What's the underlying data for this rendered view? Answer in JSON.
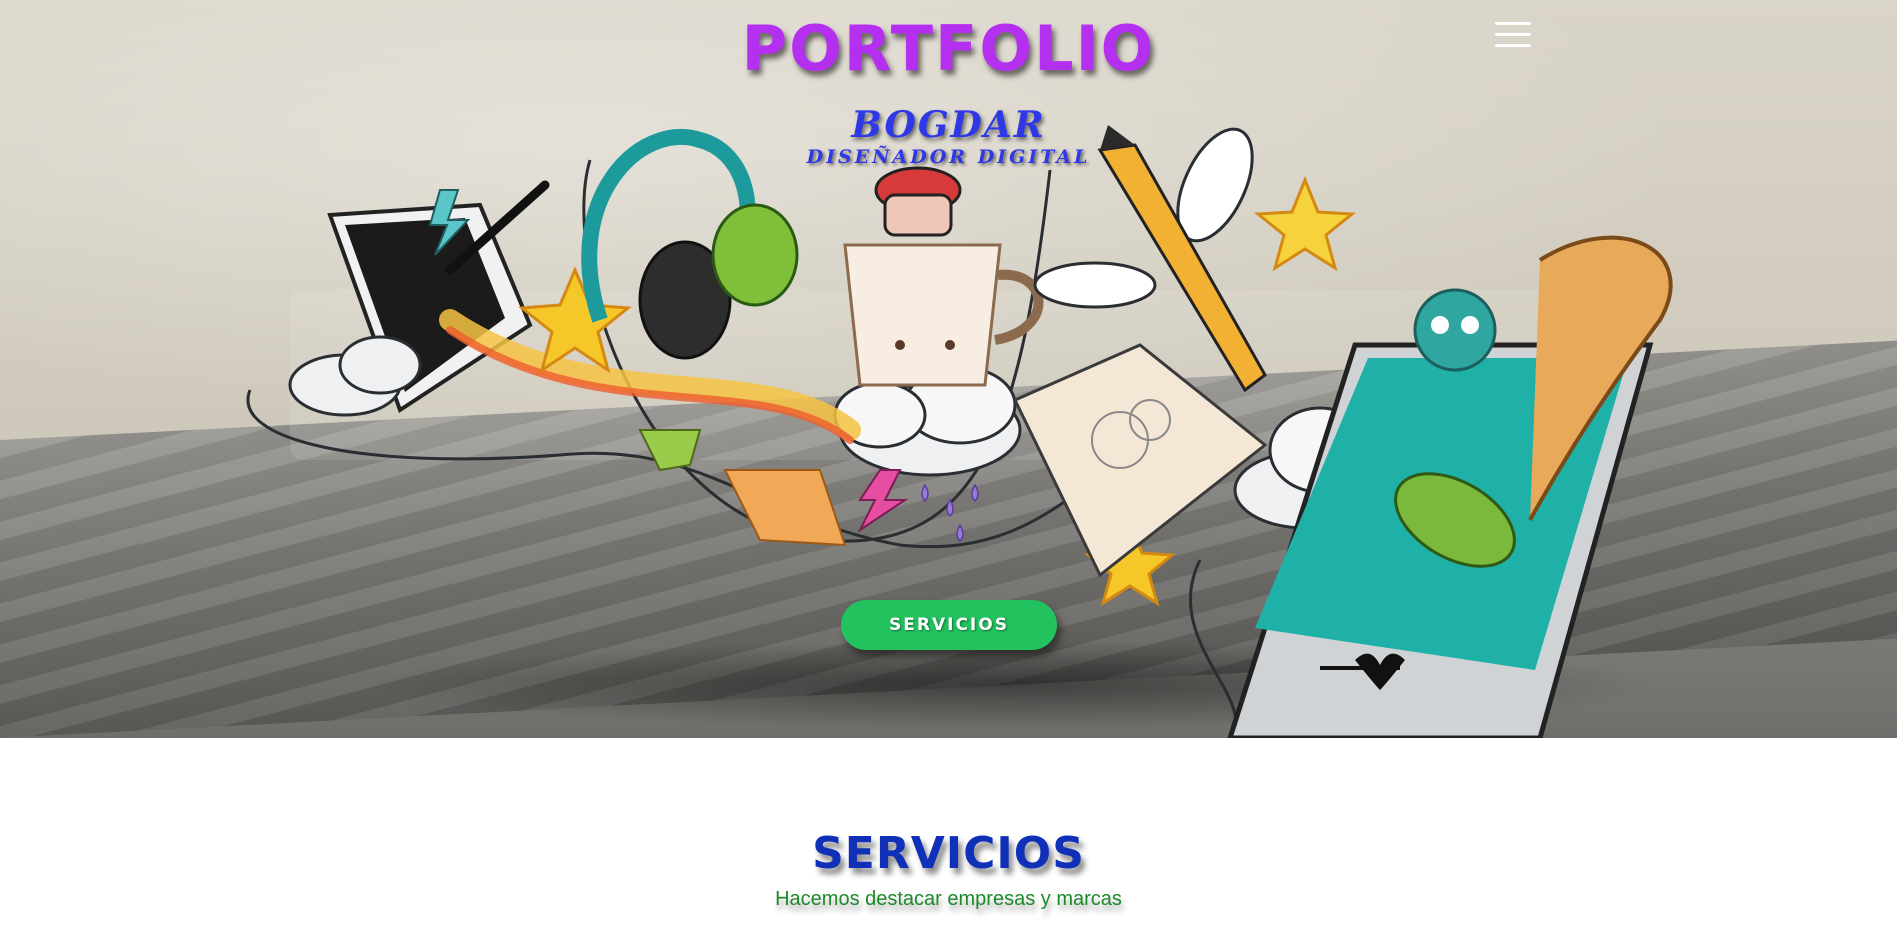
{
  "header": {
    "title": "PORTFOLIO",
    "menu_icon": "hamburger-menu-icon"
  },
  "hero": {
    "brand_name": "BOGDAR",
    "brand_role": "DISEÑADOR DIGITAL",
    "cta_label": "SERVICIOS",
    "colors": {
      "title": "#b52ff0",
      "brand": "#2f38e6",
      "cta": "#22c25f"
    }
  },
  "services": {
    "title": "SERVICIOS",
    "subtitle": "Hacemos destacar empresas y marcas",
    "colors": {
      "title": "#1030b8",
      "subtitle": "#1c8a2a"
    }
  }
}
